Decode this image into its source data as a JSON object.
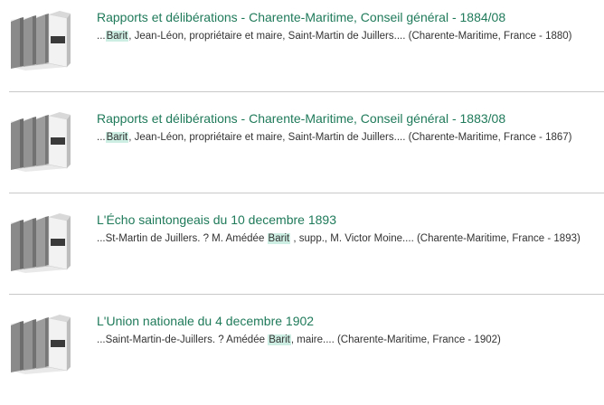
{
  "colors": {
    "title": "#1f7a5a",
    "highlight": "#cdeee3",
    "snippet": "#333333",
    "divider": "#c9c9c9"
  },
  "results": [
    {
      "icon": "book-volumes-icon",
      "title": "Rapports et délibérations - Charente-Maritime, Conseil général - 1884/08",
      "snippet_pre": "...",
      "highlight": "Barit",
      "snippet_post": ", Jean-Léon, propriétaire et maire, Saint-Martin de Juillers.... (Charente-Maritime, France - 1880)"
    },
    {
      "icon": "book-volumes-icon",
      "title": "Rapports et délibérations - Charente-Maritime, Conseil général - 1883/08",
      "snippet_pre": "...",
      "highlight": "Barit",
      "snippet_post": ", Jean-Léon, propriétaire et maire, Saint-Martin de Juillers.... (Charente-Maritime, France - 1867)"
    },
    {
      "icon": "book-volumes-icon",
      "title": "L'Écho saintongeais du 10 decembre 1893",
      "snippet_pre": "...St-Martin de Juillers. ? M. Amédée ",
      "highlight": "Barit",
      "snippet_post": " , supp., M. Victor Moine.... (Charente-Maritime, France - 1893)"
    },
    {
      "icon": "book-volumes-icon",
      "title": "L'Union nationale du 4 decembre 1902",
      "snippet_pre": "...Saint-Martin-de-Juillers. ? Amédée ",
      "highlight": "Barit",
      "snippet_post": ", maire.... (Charente-Maritime, France - 1902)"
    }
  ]
}
